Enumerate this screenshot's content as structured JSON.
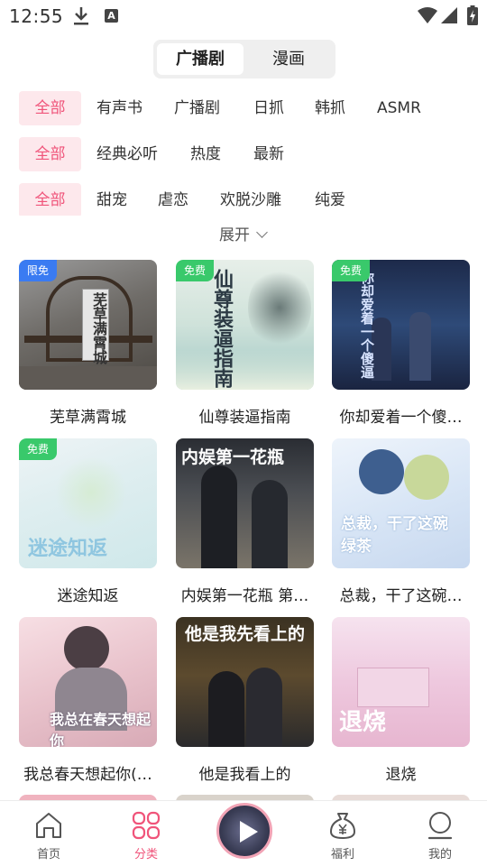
{
  "status_bar": {
    "time": "12:55",
    "a_glyph": "A",
    "icons": [
      "download-icon",
      "a-icon",
      "wifi-icon",
      "cell-signal-icon",
      "battery-charging-icon"
    ]
  },
  "segment": {
    "active": "广播剧",
    "inactive": "漫画"
  },
  "filters": {
    "row1": [
      "全部",
      "有声书",
      "广播剧",
      "日抓",
      "韩抓",
      "ASMR"
    ],
    "row2": [
      "全部",
      "经典必听",
      "热度",
      "最新"
    ],
    "row3": [
      "全部",
      "甜宠",
      "虐恋",
      "欢脱沙雕",
      "纯爱"
    ]
  },
  "expand_label": "展开",
  "cards": [
    {
      "title": "芜草满霄城",
      "badge": "限免",
      "badge_color": "blue",
      "art": "芜草满霄城"
    },
    {
      "title": "仙尊装逼指南",
      "badge": "免费",
      "badge_color": "green",
      "art": "仙尊装逼指南"
    },
    {
      "title": "你却爱着一个傻…",
      "badge": "免费",
      "badge_color": "green",
      "art": "你却爱着一个傻逼"
    },
    {
      "title": "迷途知返",
      "badge": "免费",
      "badge_color": "green",
      "art": "迷途知返"
    },
    {
      "title": "内娱第一花瓶 第…",
      "badge": "",
      "badge_color": "",
      "art": "内娱第一花瓶"
    },
    {
      "title": "总裁，干了这碗…",
      "badge": "",
      "badge_color": "",
      "art": "总裁，干了这碗绿茶"
    },
    {
      "title": "我总春天想起你(…",
      "badge": "",
      "badge_color": "",
      "art": "我总在春天想起你"
    },
    {
      "title": "他是我看上的",
      "badge": "",
      "badge_color": "",
      "art": "他是我先看上的"
    },
    {
      "title": "退烧",
      "badge": "",
      "badge_color": "",
      "art": "退烧"
    }
  ],
  "bottom_nav": [
    {
      "label": "首页",
      "icon": "home-icon",
      "active": false
    },
    {
      "label": "分类",
      "icon": "category-icon",
      "active": true
    },
    {
      "label": "",
      "icon": "play-icon",
      "active": false
    },
    {
      "label": "福利",
      "icon": "money-bag-icon",
      "active": false
    },
    {
      "label": "我的",
      "icon": "profile-icon",
      "active": false
    }
  ],
  "colors": {
    "accent": "#f0547a",
    "accent_bg": "#fde8ec",
    "free_badge": "#39c96b",
    "limited_badge": "#3a7bf2"
  }
}
